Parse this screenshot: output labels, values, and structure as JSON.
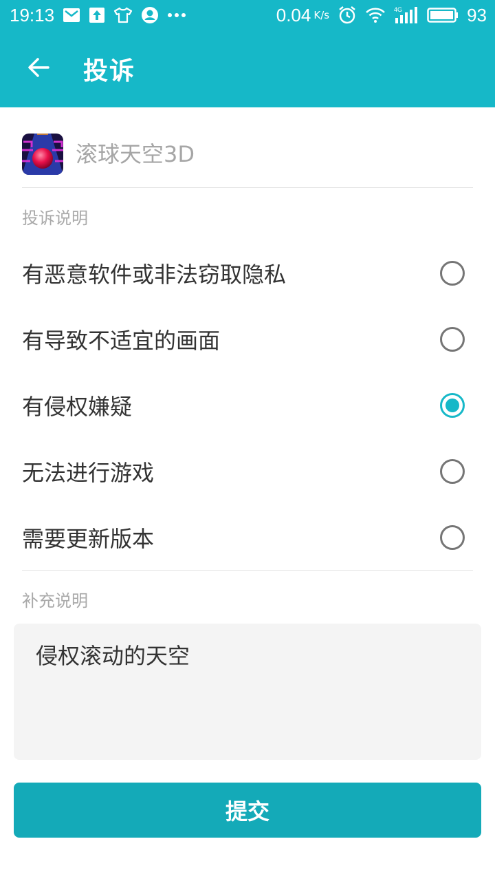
{
  "status_bar": {
    "time": "19:13",
    "network_speed": "0.04",
    "network_speed_unit": "K/s",
    "signal_type": "4G",
    "battery": "93",
    "icons": [
      "mail-icon",
      "upload-icon",
      "tshirt-icon",
      "account-icon",
      "more-icon",
      "alarm-icon",
      "wifi-icon",
      "signal-icon",
      "battery-icon"
    ]
  },
  "header": {
    "title": "投诉",
    "back_icon": "arrow-left-icon"
  },
  "app": {
    "name": "滚球天空3D",
    "icon": "game-icon"
  },
  "complaint": {
    "section_label": "投诉说明",
    "options": [
      {
        "label": "有恶意软件或非法窃取隐私",
        "selected": false
      },
      {
        "label": "有导致不适宜的画面",
        "selected": false
      },
      {
        "label": "有侵权嫌疑",
        "selected": true
      },
      {
        "label": "无法进行游戏",
        "selected": false
      },
      {
        "label": "需要更新版本",
        "selected": false
      }
    ]
  },
  "supplement": {
    "section_label": "补充说明",
    "value": "侵权滚动的天空"
  },
  "submit_label": "提交",
  "colors": {
    "accent": "#16b8c8",
    "button": "#14aab8",
    "text": "#333333",
    "hint": "#a9a9a9"
  }
}
